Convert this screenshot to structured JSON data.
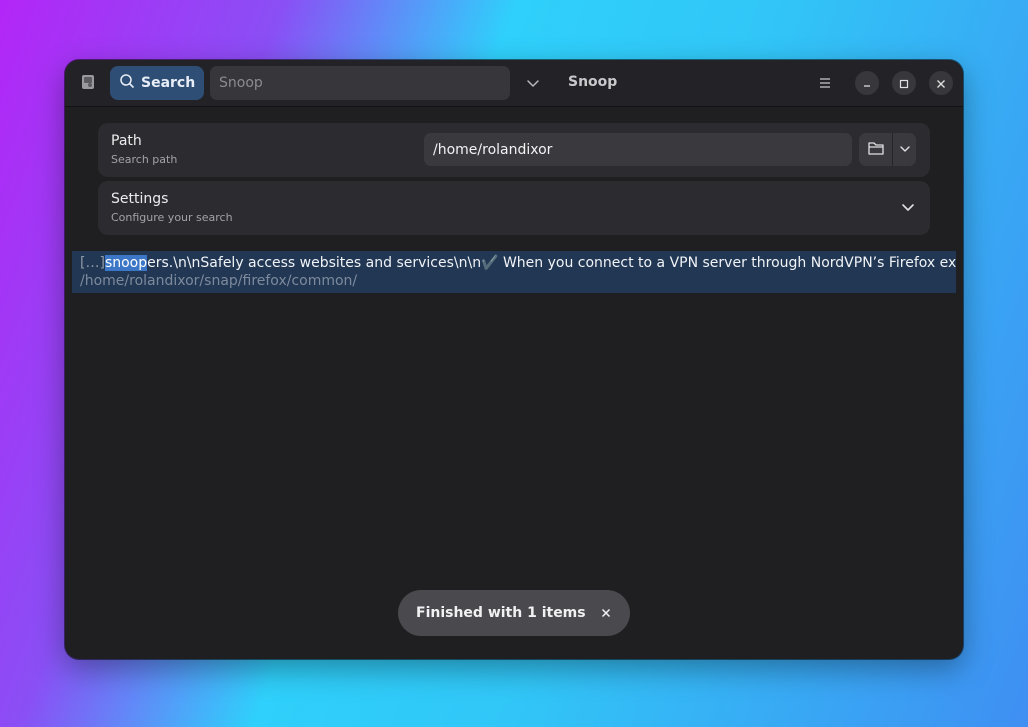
{
  "header": {
    "search_button_label": "Search",
    "search_placeholder": "Snoop",
    "title": "Snoop"
  },
  "path_row": {
    "title": "Path",
    "subtitle": "Search path",
    "value": "/home/rolandixor"
  },
  "settings_row": {
    "title": "Settings",
    "subtitle": "Configure your search"
  },
  "results": [
    {
      "prefix": "[…]",
      "match": "snoop",
      "rest": "ers.\\n\\nSafely access websites and services\\n\\n✔️ When you connect to a VPN server through NordVPN’s Firefox extension",
      "path": "/home/rolandixor/snap/firefox/common/"
    }
  ],
  "toast": {
    "message": "Finished with 1 items"
  },
  "colors": {
    "accent": "#2e4e76",
    "highlight": "#3b76c7",
    "window_bg": "#1f1f22"
  }
}
